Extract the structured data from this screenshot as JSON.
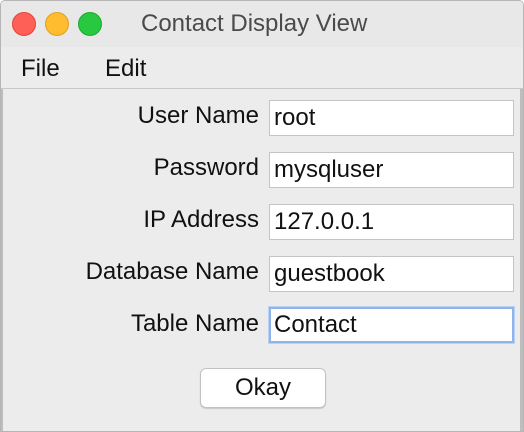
{
  "window": {
    "title": "Contact Display View"
  },
  "menubar": {
    "items": [
      {
        "label": "File"
      },
      {
        "label": "Edit"
      }
    ]
  },
  "form": {
    "fields": [
      {
        "label": "User Name",
        "value": "root"
      },
      {
        "label": "Password",
        "value": "mysqluser"
      },
      {
        "label": "IP Address",
        "value": "127.0.0.1"
      },
      {
        "label": "Database Name",
        "value": "guestbook"
      },
      {
        "label": "Table Name",
        "value": "Contact"
      }
    ],
    "submit_label": "Okay"
  },
  "colors": {
    "close": "#fe5f57",
    "minimize": "#febc2e",
    "maximize": "#28c840",
    "focus_ring": "#8fb4ea"
  },
  "icons": {
    "close": "close-icon",
    "minimize": "minimize-icon",
    "maximize": "maximize-icon"
  }
}
